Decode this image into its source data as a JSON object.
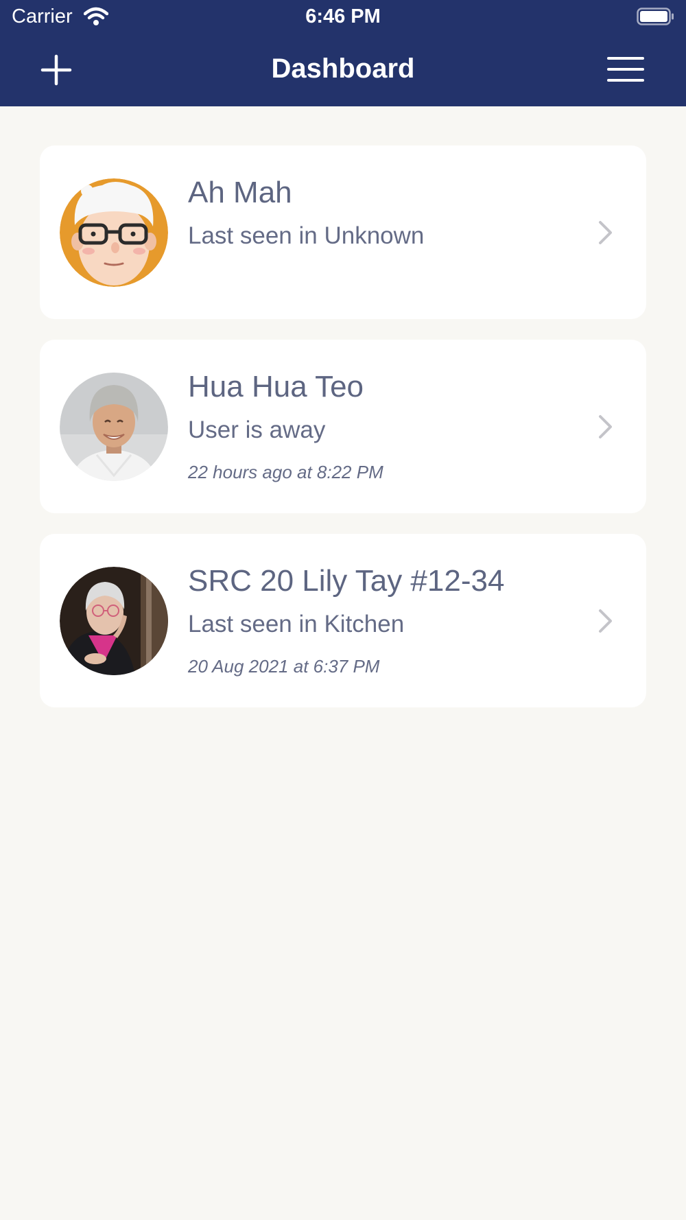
{
  "status_bar": {
    "carrier": "Carrier",
    "time": "6:46 PM"
  },
  "nav": {
    "title": "Dashboard",
    "add_icon": "plus-icon",
    "menu_icon": "hamburger-menu-icon"
  },
  "users": [
    {
      "name": "Ah Mah",
      "status": "Last seen in Unknown",
      "time": "",
      "avatar": "cartoon-grandma-avatar"
    },
    {
      "name": "Hua Hua Teo",
      "status": "User is away",
      "time": "22 hours ago at 8:22 PM",
      "avatar": "elderly-woman-photo"
    },
    {
      "name": "SRC 20 Lily Tay #12-34",
      "status": "Last seen in Kitchen",
      "time": "20 Aug 2021 at 6:37 PM",
      "avatar": "elderly-woman-photo"
    }
  ],
  "colors": {
    "header": "#23336b",
    "background": "#f8f7f3",
    "card": "#ffffff",
    "text": "#5d6581",
    "chevron": "#c4c4c9"
  }
}
